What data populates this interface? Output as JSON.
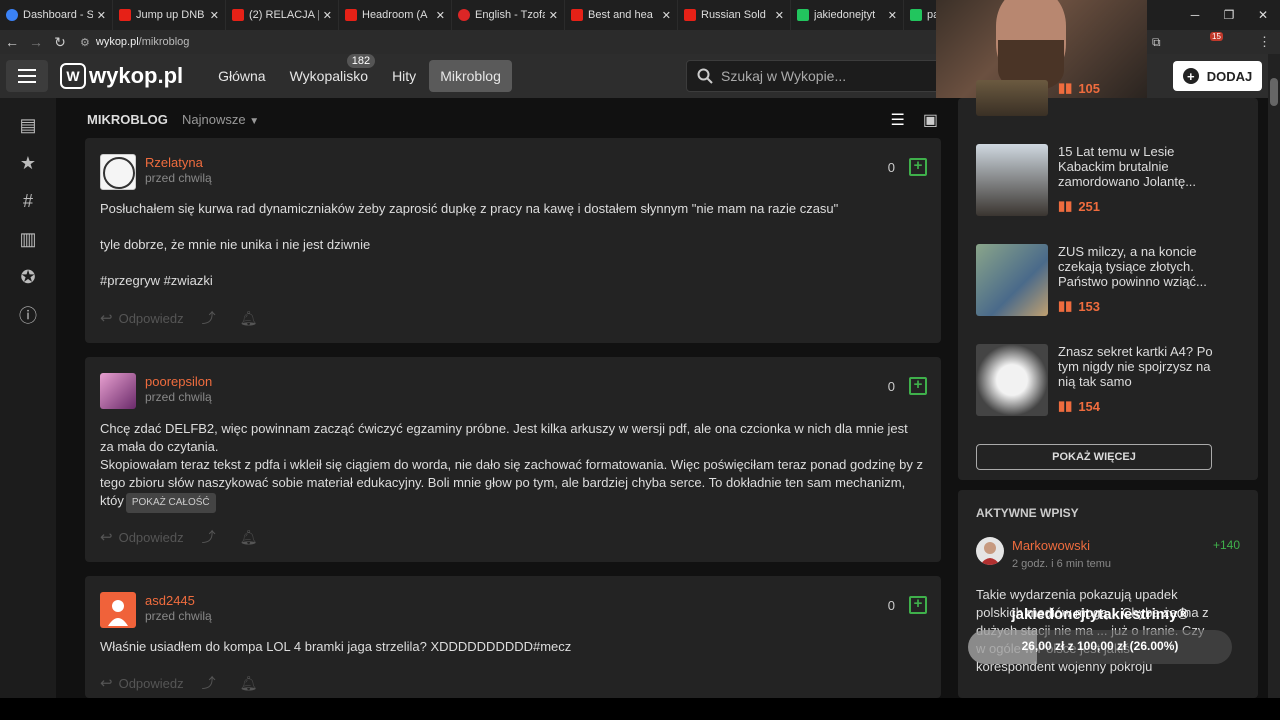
{
  "browser": {
    "tabs": [
      {
        "title": "Dashboard - Stre",
        "fav": "blue"
      },
      {
        "title": "Jump up DNB mi",
        "fav": "yt"
      },
      {
        "title": "(2) RELACJA |",
        "fav": "yt"
      },
      {
        "title": "Headroom (A",
        "fav": "yt"
      },
      {
        "title": "English - Tzofar -",
        "fav": "red"
      },
      {
        "title": "Best and hea",
        "fav": "yt"
      },
      {
        "title": "Russian Sold",
        "fav": "yt"
      },
      {
        "title": "jakiedonejtyt",
        "fav": "green"
      },
      {
        "title": "paja",
        "fav": "green"
      }
    ],
    "url_host": "wykop.pl",
    "url_path": "/mikroblog",
    "ext_badge": "15"
  },
  "header": {
    "logo": "wykop.pl",
    "nav": [
      {
        "label": "Główna",
        "badge": null
      },
      {
        "label": "Wykopalisko",
        "badge": "182"
      },
      {
        "label": "Hity",
        "badge": null
      },
      {
        "label": "Mikroblog",
        "badge": null
      }
    ],
    "search_placeholder": "Szukaj w Wykopie...",
    "add_label": "DODAJ"
  },
  "main": {
    "title": "MIKROBLOG",
    "sort": "Najnowsze",
    "reply_label": "Odpowiedz",
    "posts": [
      {
        "author": "Rzelatyna",
        "time": "przed chwilą",
        "score": "0",
        "paragraphs": [
          "Posłuchałem się kurwa rad dynamiczniaków żeby zaprosić dupkę z pracy na kawę i dostałem słynnym \"nie mam na razie czasu\"",
          "tyle dobrze, że mnie nie unika i nie jest dziwnie",
          "#przegryw #zwiazki"
        ]
      },
      {
        "author": "poorepsilon",
        "time": "przed chwilą",
        "score": "0",
        "paragraphs": [
          "Chcę zdać DELFB2, więc powinnam zacząć ćwiczyć egzaminy próbne. Jest kilka arkuszy w wersji pdf, ale ona czcionka w nich dla mnie jest za mała do czytania.",
          "Skopiowałam teraz tekst z pdfa i wkleił się ciągiem do worda, nie dało się zachować formatowania. Więc poświęciłam teraz ponad godzinę by z tego zbioru słów naszykować sobie materiał edukacyjny. Boli mnie głow po tym, ale bardziej chyba serce. To dokładnie ten sam mechanizm, któy"
        ],
        "more": "POKAŻ CAŁOŚĆ"
      },
      {
        "author": "asd2445",
        "time": "przed chwilą",
        "score": "0",
        "paragraphs": [
          "Właśnie usiadłem do kompa LOL 4 bramki jaga strzelila? XDDDDDDDDDD#mecz"
        ]
      }
    ]
  },
  "sidebar": {
    "links": [
      {
        "title": "",
        "votes": "105"
      },
      {
        "title": "15 Lat temu w Lesie Kabackim brutalnie zamordowano Jolantę...",
        "votes": "251"
      },
      {
        "title": "ZUS milczy, a na koncie czekają tysiące złotych. Państwo powinno wziąć...",
        "votes": "153"
      },
      {
        "title": "Znasz sekret kartki A4? Po tym nigdy nie spojrzysz na nią tak samo",
        "votes": "154"
      }
    ],
    "show_more": "POKAŻ WIĘCEJ",
    "active": {
      "title": "AKTYWNE WPISY",
      "author": "Markowowski",
      "time": "2 godz. i 6 min temu",
      "score": "+140",
      "text": "Takie wydarzenia pokazują upadek polskich mediów mogą... Chyba żadna z dużych stacji nie ma ... już o Iranie. Czy w ogóle w Polsce jest jakiś korespondent wojenny pokroju"
    }
  },
  "donation": {
    "name": "jakiedonejtytakiestrimy®",
    "amount": "26,00 zł z 100,00 zł (26.00%)",
    "progress": 0.26
  },
  "colors": {
    "accent": "#ef6c3e",
    "plus": "#3fb04b"
  }
}
